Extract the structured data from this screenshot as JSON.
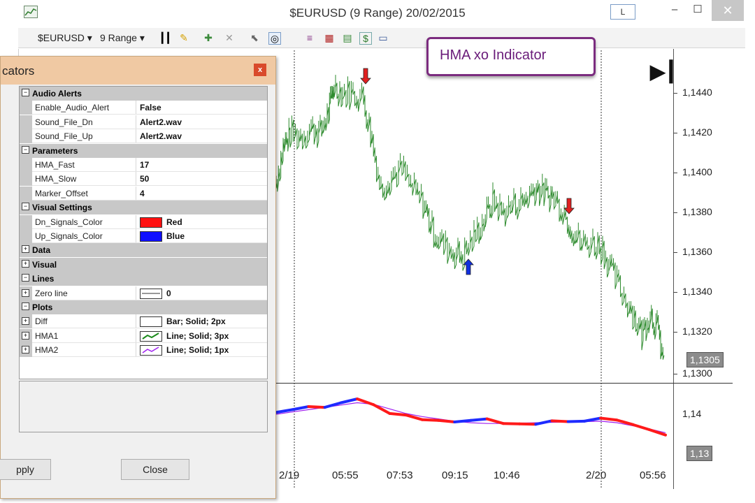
{
  "window": {
    "title": "$EURUSD (9 Range)  20/02/2015",
    "l_button": "L",
    "minimize": "–",
    "maximize": "☐",
    "close": "✕"
  },
  "toolbar": {
    "instrument": "$EURUSD ▾",
    "period": "9 Range ▾"
  },
  "callout": {
    "text": "HMA xo Indicator"
  },
  "chart": {
    "price_labels": [
      "1,1440",
      "1,1420",
      "1,1400",
      "1,1380",
      "1,1360",
      "1,1340",
      "1,1320",
      "1,1300"
    ],
    "current_price": "1,1305",
    "lower_labels": [
      "1,14",
      "1,13"
    ],
    "time_labels": [
      "2/19",
      "05:55",
      "07:53",
      "09:15",
      "10:46",
      "2/20",
      "05:56"
    ],
    "colors": {
      "bars": "#2e8b2e",
      "down_signal": "#e02020",
      "up_signal": "#1030e0",
      "hma_fast_up": "#1e2bff",
      "hma_fast_dn": "#ff1a1a",
      "hma_slow": "#a020f0"
    }
  },
  "chart_data": {
    "type": "line",
    "series": [
      {
        "name": "HMA1",
        "values": [
          1.1405,
          1.1412,
          1.142,
          1.1418,
          1.143,
          1.144,
          1.1425,
          1.1402,
          1.1398,
          1.1386,
          1.1384,
          1.138,
          1.1384,
          1.1388,
          1.1376,
          1.1375,
          1.1374,
          1.1383,
          1.1381,
          1.1382,
          1.139,
          1.1385,
          1.1373,
          1.136,
          1.1346
        ]
      },
      {
        "name": "HMA2",
        "values": [
          1.14,
          1.1406,
          1.1412,
          1.1418,
          1.1424,
          1.143,
          1.1426,
          1.1414,
          1.1402,
          1.1394,
          1.1388,
          1.1382,
          1.1378,
          1.1376,
          1.1376,
          1.1377,
          1.1378,
          1.1379,
          1.138,
          1.1381,
          1.1382,
          1.1378,
          1.137,
          1.1362,
          1.1352
        ]
      }
    ]
  },
  "dialog": {
    "title": "cators",
    "close": "x",
    "rows": [
      {
        "kind": "cat",
        "label": "Audio Alerts",
        "exp": "−"
      },
      {
        "kind": "prop",
        "name": "Enable_Audio_Alert",
        "value": "False"
      },
      {
        "kind": "prop",
        "name": "Sound_File_Dn",
        "value": "Alert2.wav"
      },
      {
        "kind": "prop",
        "name": "Sound_File_Up",
        "value": "Alert2.wav"
      },
      {
        "kind": "cat",
        "label": "Parameters",
        "exp": "−"
      },
      {
        "kind": "prop",
        "name": "HMA_Fast",
        "value": "17"
      },
      {
        "kind": "prop",
        "name": "HMA_Slow",
        "value": "50"
      },
      {
        "kind": "prop",
        "name": "Marker_Offset",
        "value": "4"
      },
      {
        "kind": "cat",
        "label": "Visual Settings",
        "exp": "−"
      },
      {
        "kind": "prop",
        "name": "Dn_Signals_Color",
        "value": "Red",
        "swatch": "#ff1010"
      },
      {
        "kind": "prop",
        "name": "Up_Signals_Color",
        "value": "Blue",
        "swatch": "#1010ff"
      },
      {
        "kind": "cat",
        "label": "Data",
        "exp": "+"
      },
      {
        "kind": "cat",
        "label": "Visual",
        "exp": "+"
      },
      {
        "kind": "cat",
        "label": "Lines",
        "exp": "−"
      },
      {
        "kind": "prop",
        "name": "Zero line",
        "value": "0",
        "swatch": "#ffffff",
        "expand": "+"
      },
      {
        "kind": "cat",
        "label": "Plots",
        "exp": "−"
      },
      {
        "kind": "prop",
        "name": "Diff",
        "value": "Bar; Solid; 2px",
        "swatch": "#ffffff",
        "expand": "+"
      },
      {
        "kind": "prop",
        "name": "HMA1",
        "value": "Line; Solid; 3px",
        "swatch": "#ffffff",
        "expand": "+"
      },
      {
        "kind": "prop",
        "name": "HMA2",
        "value": "Line; Solid; 1px",
        "swatch": "#ffffff",
        "expand": "+"
      }
    ],
    "apply": "pply",
    "close_button": "Close"
  }
}
